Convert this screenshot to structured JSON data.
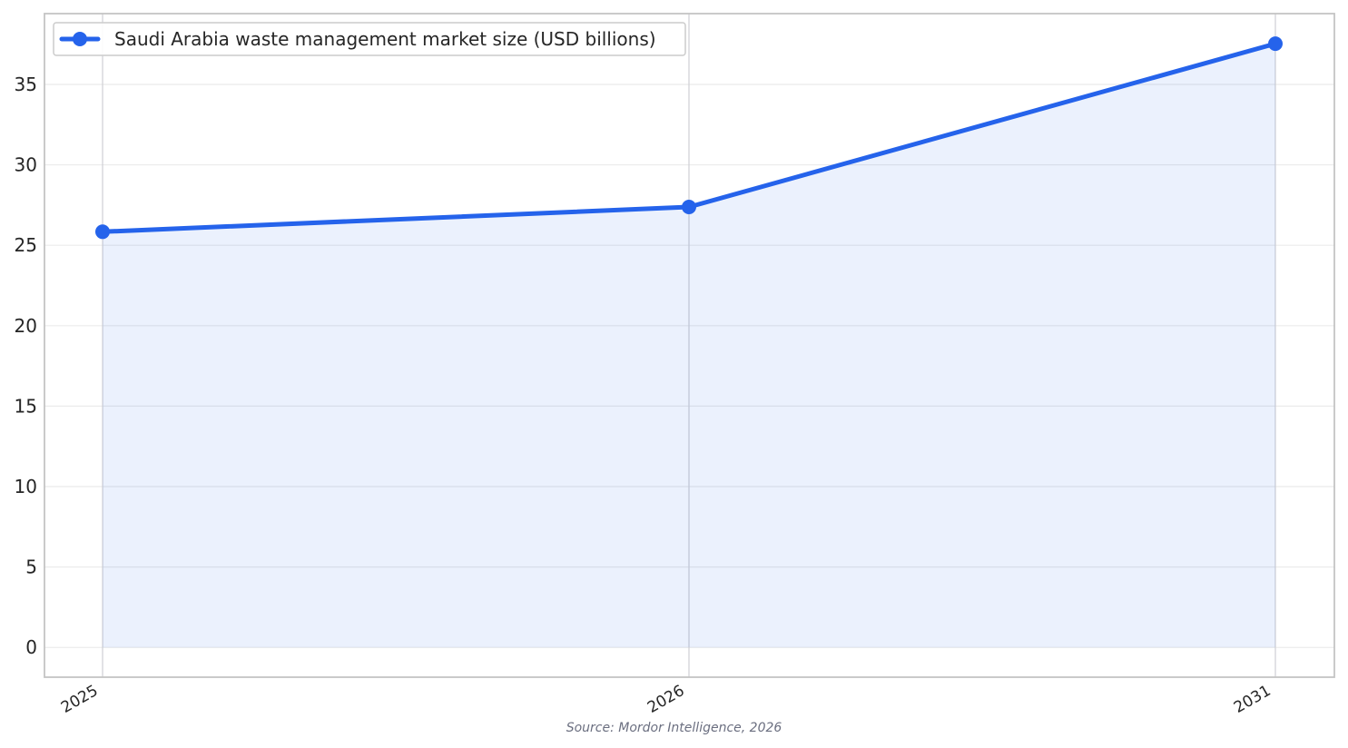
{
  "chart_data": {
    "type": "area",
    "x": [
      "2025",
      "2026",
      "2031"
    ],
    "series": [
      {
        "name": "Saudi Arabia waste management market size (USD billions)",
        "values": [
          25.84,
          27.38,
          37.53
        ]
      }
    ],
    "ylim": [
      -1.85,
      39.4
    ],
    "yticks": [
      0,
      5,
      10,
      15,
      20,
      25,
      30,
      35
    ],
    "grid": true,
    "legend_position": "top-left",
    "line_color": "#2563eb",
    "fill_color": "#2563eb",
    "source": "Source: Mordor Intelligence, 2026"
  }
}
